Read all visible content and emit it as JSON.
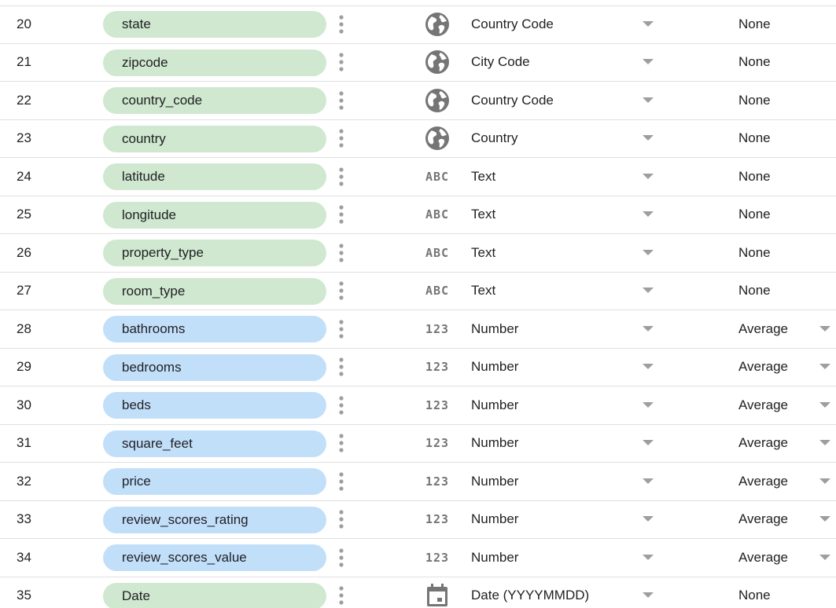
{
  "colors": {
    "dimension_pill": "#cfe8cf",
    "metric_pill": "#c2dffa",
    "icon_grey": "#757575",
    "caret_grey": "#9e9e9e",
    "divider": "#e0e0e0"
  },
  "fields": [
    {
      "index": "20",
      "name": "state",
      "kind": "dimension",
      "type_icon": "globe-icon",
      "type": "Country Code",
      "aggregation": "None",
      "agg_dropdown": false
    },
    {
      "index": "21",
      "name": "zipcode",
      "kind": "dimension",
      "type_icon": "globe-icon",
      "type": "City Code",
      "aggregation": "None",
      "agg_dropdown": false
    },
    {
      "index": "22",
      "name": "country_code",
      "kind": "dimension",
      "type_icon": "globe-icon",
      "type": "Country Code",
      "aggregation": "None",
      "agg_dropdown": false
    },
    {
      "index": "23",
      "name": "country",
      "kind": "dimension",
      "type_icon": "globe-icon",
      "type": "Country",
      "aggregation": "None",
      "agg_dropdown": false
    },
    {
      "index": "24",
      "name": "latitude",
      "kind": "dimension",
      "type_icon": "abc-text-icon",
      "type_glyph": "ABC",
      "type": "Text",
      "aggregation": "None",
      "agg_dropdown": false
    },
    {
      "index": "25",
      "name": "longitude",
      "kind": "dimension",
      "type_icon": "abc-text-icon",
      "type_glyph": "ABC",
      "type": "Text",
      "aggregation": "None",
      "agg_dropdown": false
    },
    {
      "index": "26",
      "name": "property_type",
      "kind": "dimension",
      "type_icon": "abc-text-icon",
      "type_glyph": "ABC",
      "type": "Text",
      "aggregation": "None",
      "agg_dropdown": false
    },
    {
      "index": "27",
      "name": "room_type",
      "kind": "dimension",
      "type_icon": "abc-text-icon",
      "type_glyph": "ABC",
      "type": "Text",
      "aggregation": "None",
      "agg_dropdown": false
    },
    {
      "index": "28",
      "name": "bathrooms",
      "kind": "metric",
      "type_icon": "number-123-icon",
      "type_glyph": "123",
      "type": "Number",
      "aggregation": "Average",
      "agg_dropdown": true
    },
    {
      "index": "29",
      "name": "bedrooms",
      "kind": "metric",
      "type_icon": "number-123-icon",
      "type_glyph": "123",
      "type": "Number",
      "aggregation": "Average",
      "agg_dropdown": true
    },
    {
      "index": "30",
      "name": "beds",
      "kind": "metric",
      "type_icon": "number-123-icon",
      "type_glyph": "123",
      "type": "Number",
      "aggregation": "Average",
      "agg_dropdown": true
    },
    {
      "index": "31",
      "name": "square_feet",
      "kind": "metric",
      "type_icon": "number-123-icon",
      "type_glyph": "123",
      "type": "Number",
      "aggregation": "Average",
      "agg_dropdown": true
    },
    {
      "index": "32",
      "name": "price",
      "kind": "metric",
      "type_icon": "number-123-icon",
      "type_glyph": "123",
      "type": "Number",
      "aggregation": "Average",
      "agg_dropdown": true
    },
    {
      "index": "33",
      "name": "review_scores_rating",
      "kind": "metric",
      "type_icon": "number-123-icon",
      "type_glyph": "123",
      "type": "Number",
      "aggregation": "Average",
      "agg_dropdown": true
    },
    {
      "index": "34",
      "name": "review_scores_value",
      "kind": "metric",
      "type_icon": "number-123-icon",
      "type_glyph": "123",
      "type": "Number",
      "aggregation": "Average",
      "agg_dropdown": true
    },
    {
      "index": "35",
      "name": "Date",
      "kind": "dimension",
      "type_icon": "calendar-icon",
      "type": "Date (YYYYMMDD)",
      "aggregation": "None",
      "agg_dropdown": false
    }
  ]
}
